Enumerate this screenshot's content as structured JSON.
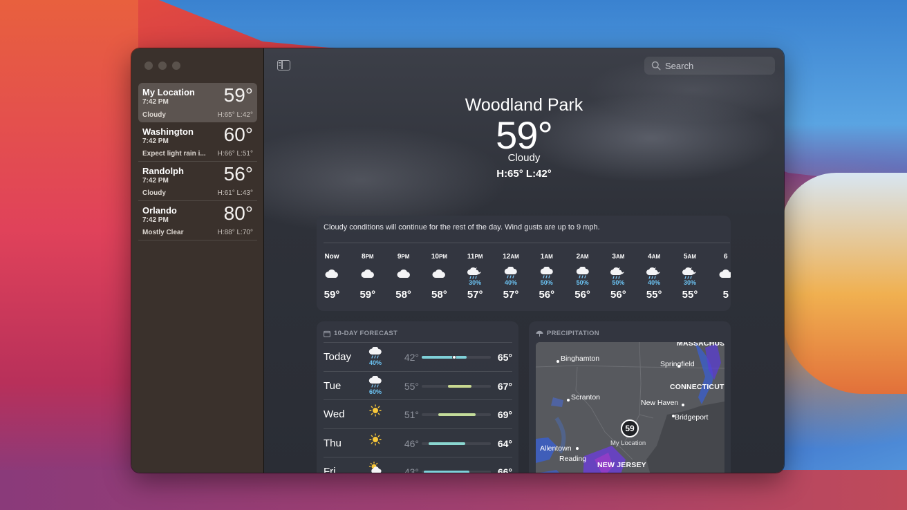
{
  "sidebar": {
    "locations": [
      {
        "name": "My Location",
        "time": "7:42 PM",
        "temp": "59°",
        "condition": "Cloudy",
        "hl": "H:65°  L:42°",
        "selected": true
      },
      {
        "name": "Washington",
        "time": "7:42 PM",
        "temp": "60°",
        "condition": "Expect light rain i...",
        "hl": "H:66°  L:51°"
      },
      {
        "name": "Randolph",
        "time": "7:42 PM",
        "temp": "56°",
        "condition": "Cloudy",
        "hl": "H:61°  L:43°"
      },
      {
        "name": "Orlando",
        "time": "7:42 PM",
        "temp": "80°",
        "condition": "Mostly Clear",
        "hl": "H:88°  L:70°"
      }
    ]
  },
  "toolbar": {
    "search_placeholder": "Search",
    "sidebar_toggle_icon": "sidebar-toggle-icon",
    "search_icon": "magnifying-glass-icon"
  },
  "current": {
    "city": "Woodland Park",
    "temp": "59°",
    "condition": "Cloudy",
    "hl": "H:65°  L:42°"
  },
  "hourly": {
    "summary": "Cloudy conditions will continue for the rest of the day. Wind gusts are up to 9 mph.",
    "hours": [
      {
        "label": "Now",
        "suffix": "",
        "icon": "cloud",
        "pop": "",
        "temp": "59°"
      },
      {
        "label": "8",
        "suffix": "PM",
        "icon": "cloud",
        "pop": "",
        "temp": "59°"
      },
      {
        "label": "9",
        "suffix": "PM",
        "icon": "cloud",
        "pop": "",
        "temp": "58°"
      },
      {
        "label": "10",
        "suffix": "PM",
        "icon": "cloud",
        "pop": "",
        "temp": "58°"
      },
      {
        "label": "11",
        "suffix": "PM",
        "icon": "cloud-moon-rain",
        "pop": "30%",
        "temp": "57°"
      },
      {
        "label": "12",
        "suffix": "AM",
        "icon": "cloud-rain",
        "pop": "40%",
        "temp": "57°"
      },
      {
        "label": "1",
        "suffix": "AM",
        "icon": "cloud-rain",
        "pop": "50%",
        "temp": "56°"
      },
      {
        "label": "2",
        "suffix": "AM",
        "icon": "cloud-rain",
        "pop": "50%",
        "temp": "56°"
      },
      {
        "label": "3",
        "suffix": "AM",
        "icon": "cloud-moon-rain",
        "pop": "50%",
        "temp": "56°"
      },
      {
        "label": "4",
        "suffix": "AM",
        "icon": "cloud-moon-rain",
        "pop": "40%",
        "temp": "55°"
      },
      {
        "label": "5",
        "suffix": "AM",
        "icon": "cloud-moon-rain",
        "pop": "30%",
        "temp": "55°"
      },
      {
        "label": "6",
        "suffix": "",
        "icon": "cloud",
        "pop": "",
        "temp": "5"
      }
    ]
  },
  "forecast": {
    "title": "10-DAY FORECAST",
    "icon": "calendar-icon",
    "days": [
      {
        "day": "Today",
        "icon": "cloud-rain",
        "pop": "40%",
        "lo": "42°",
        "hi": "65°",
        "bar_start": 0.0,
        "bar_end": 0.65,
        "current": 0.47,
        "color": "#7fd0d8"
      },
      {
        "day": "Tue",
        "icon": "cloud-rain",
        "pop": "60%",
        "lo": "55°",
        "hi": "67°",
        "bar_start": 0.38,
        "bar_end": 0.72,
        "color": "#c8d890"
      },
      {
        "day": "Wed",
        "icon": "sun",
        "pop": "",
        "lo": "51°",
        "hi": "69°",
        "bar_start": 0.24,
        "bar_end": 0.78,
        "color": "#c4dc9a"
      },
      {
        "day": "Thu",
        "icon": "sun",
        "pop": "",
        "lo": "46°",
        "hi": "64°",
        "bar_start": 0.1,
        "bar_end": 0.63,
        "color": "#8ad6d0"
      },
      {
        "day": "Fri",
        "icon": "cloud-sun",
        "pop": "",
        "lo": "43°",
        "hi": "66°",
        "bar_start": 0.03,
        "bar_end": 0.69,
        "color": "#7ed0da"
      }
    ]
  },
  "precipitation": {
    "title": "PRECIPITATION",
    "icon": "umbrella-icon",
    "marker_value": "59",
    "marker_caption": "My Location",
    "labels": [
      {
        "text": "MASSACHUS",
        "bold": true
      },
      {
        "text": "Binghamton",
        "bold": false
      },
      {
        "text": "Springfield",
        "bold": false
      },
      {
        "text": "CONNECTICUT",
        "bold": true
      },
      {
        "text": "Scranton",
        "bold": false
      },
      {
        "text": "New Haven",
        "bold": false
      },
      {
        "text": "Bridgeport",
        "bold": false
      },
      {
        "text": "Allentown",
        "bold": false
      },
      {
        "text": "Reading",
        "bold": false
      },
      {
        "text": "NEW JERSEY",
        "bold": true
      }
    ]
  }
}
